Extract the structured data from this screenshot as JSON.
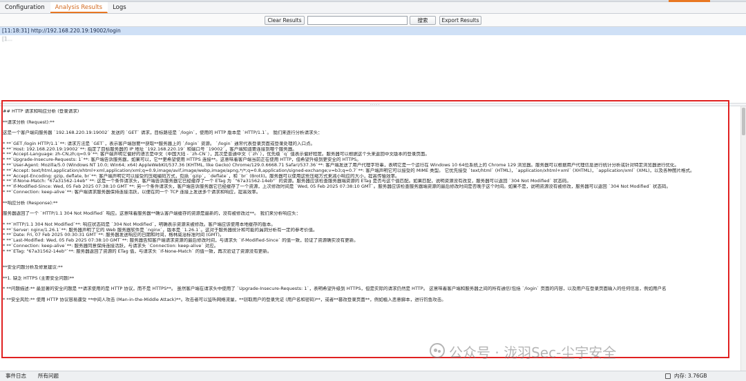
{
  "tabs": [
    {
      "label": "Configuration"
    },
    {
      "label": "Analysis Results"
    },
    {
      "label": "Logs"
    }
  ],
  "toolbar": {
    "clear_label": "Clear Results",
    "search_value": "",
    "search_label": "搜索",
    "export_label": "Export Results"
  },
  "results": [
    {
      "text": "[11:18:31] http://192.168.220.19:19002/login"
    },
    {
      "text": "[1..."
    }
  ],
  "detail_lines": [
    "## HTTP 请求和响应分析 (登录请求)",
    "",
    "**请求分析 (Request):**",
    "",
    "这是一个客户端向服务器 `192.168.220.19:19002` 发送的 `GET` 请求，目标路径是 `/login`，使用的 HTTP 版本是 `HTTP/1.1`。  我们来逐行分析请求头：",
    "",
    "* **`GET /login HTTP/1.1`**: 请求方法是 `GET`，表示客户端想要**获取**服务器上的 `/login` 资源。 `/login` 通常代表登录页面或登录处理的入口点。",
    "* **`Host: 192.168.220.19:19002`**: 指定了目标服务器的 IP 地址 `192.168.220.19` 和端口号 `19002`，客户端知道要连接到哪个服务器。",
    "* **`Accept-Language: zh-CN,zh;q=0.9`**: 客户端声明它偏好的语言是中文（中国大陆 - `zh-CN`），其次是普通中文（`zh`），优先级 `q` 值表示偏好程度。服务器可以根据这个头来返回中文版本的登录页面。",
    "* **`Upgrade-Insecure-Requests: 1`**: 客户端告诉服务器，如果可以，它**更希望使用 HTTPS 连接**。这意味着客户端当前正在使用 HTTP，但希望升级到更安全的 HTTPS。",
    "* **`User-Agent: Mozilla/5.0 (Windows NT 10.0; Win64; x64) AppleWebKit/537.36 (KHTML, like Gecko) Chrome/129.0.6668.71 Safari/537.36`**: 客户端发送了用户代理字符串，表明它是一个运行在 Windows 10 64位系统上的 Chrome 129 浏览器。服务器可以根据用户代理信息进行统计分析或针对特定浏览器进行优化。",
    "* **`Accept: text/html,application/xhtml+xml,application/xml;q=0.9,image/avif,image/webp,image/apng,*/*;q=0.8,application/signed-exchange;v=b3;q=0.7`**: 客户端声明它可以接受的 MIME 类型。 它优先接受 `text/html` (HTML)，`application/xhtml+xml` (XHTML)，`application/xml` (XML)，以及各种图片格式。",
    "* **`Accept-Encoding: gzip, deflate, br`**: 客户端声明它可以接受的压缩编码方式，包括 `gzip`，`deflate`，和 `br` (Brotli)。服务器可以使用这些压缩方式来减小响应的大小，提高传输效率。",
    "* **`If-None-Match: \"67a31562-14eb\"`**: 这是一个条件请求头，客户端告诉服务器它已经缓存了一个 ETag 为 `\"67a31562-14eb\"` 的资源。服务器应该检查服务器端资源的 ETag 是否与这个值匹配。如果匹配，说明资源没有改变，服务器可以返回 `304 Not Modified` 状态码。",
    "* **`If-Modified-Since: Wed, 05 Feb 2025 07:38:10 GMT`**: 另一个条件请求头，客户端告诉服务器它已经缓存了一个资源，上次修改时间是 `Wed, 05 Feb 2025 07:38:10 GMT`。服务器应该检查服务器端资源的最后修改时间是否晚于这个时间。如果不是，说明资源没有被修改，服务器可以返回 `304 Not Modified` 状态码。",
    "* **`Connection: keep-alive`**: 客户端请求服务器保持连接活跃，以便在同一个 TCP 连接上发送多个请求和响应，提高效率。",
    "",
    "**响应分析 (Response):**",
    "",
    "服务器返回了一个 `HTTP/1.1 304 Not Modified` 响应。这意味着服务器**确认客户端缓存的资源是最新的，没有被修改过**。  我们来分析响应头：",
    "",
    "* **`HTTP/1.1 304 Not Modified`**: 响应状态码是 `304 Not Modified`，明确表示资源未被修改。客户端应该使用本地缓存的版本。",
    "* **`Server: nginx/1.26.1`**: 服务器声明了它的 Web 服务器软件是 `nginx`，版本是 `1.26.1`。这对于服务器统计和可能的漏洞分析有一定的参考价值。",
    "* **`Date: Fri, 07 Feb 2025 00:30:31 GMT`**: 服务器发送响应的日期和时间，格林威治标准时间 (GMT)。",
    "* **`Last-Modified: Wed, 05 Feb 2025 07:38:10 GMT`**: 服务器告知客户端请求资源的最后修改时间，与请求头 `If-Modified-Since` 的值一致，验证了资源确实没有更新。",
    "* **`Connection: keep-alive`**: 服务器同意保持连接活跃，与请求头 `Connection: keep-alive` 对应。",
    "* **`ETag: \"67a31562-14eb\"`**: 服务器返回了资源的 ETag 值，与请求头 `If-None-Match` 的值一致，再次验证了资源没有更新。",
    "",
    "",
    "**安全问题分析及修复建议:**",
    "",
    "**1. 缺乏 HTTPS (主要安全问题)**",
    "",
    "* **问题描述:**  最显著的安全问题是 **请求使用的是 HTTP 协议，而不是 HTTPS**。  虽然客户端在请求头中使用了 `Upgrade-Insecure-Requests: 1`，表明希望升级到 HTTPS，但是实际的请求仍然是 HTTP。 这意味着客户端和服务器之间的所有通信(包括 `/login` 页面的内容，以及用户在登录页面输入的任何信息，例如用户名",
    "",
    "* **安全风险:**  使用 HTTP 协议容易遭受 **中间人攻击 (Man-in-the-Middle Attack)**。攻击者可以监听网络流量，**窃取用户的登录凭证 (用户名和密码)**，或者**篡改登录页面**，例如植入恶意脚本，进行钓鱼攻击。"
  ],
  "watermark": "公众号 · 泷羽Sec-尘宇安全",
  "status": {
    "event_log": "事件日志",
    "all_issues": "所有问题",
    "memory": "内存: 3.76GB"
  }
}
